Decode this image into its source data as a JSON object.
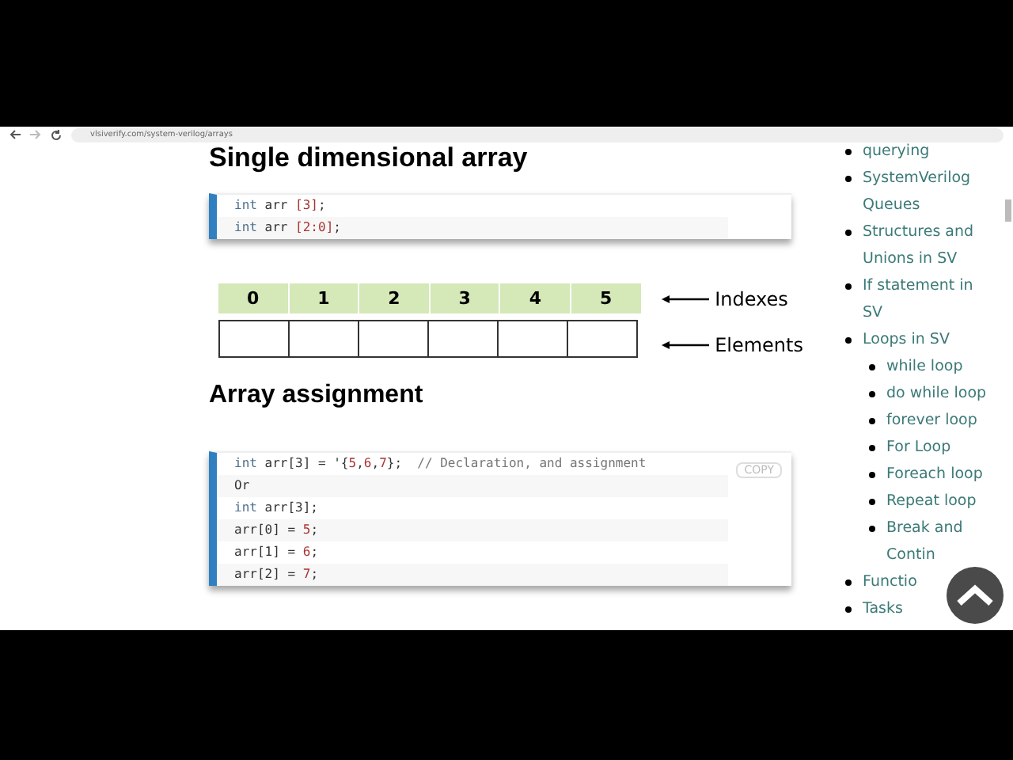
{
  "browser": {
    "url": "vlsiverify.com/system-verilog/arrays"
  },
  "sections": [
    {
      "heading": "Single dimensional array",
      "code": [
        [
          {
            "kind": "type",
            "text": "int"
          },
          {
            "kind": "plain",
            "text": " arr "
          },
          {
            "kind": "num",
            "text": "[3]"
          },
          {
            "kind": "plain",
            "text": ";"
          }
        ],
        [
          {
            "kind": "type",
            "text": "int"
          },
          {
            "kind": "plain",
            "text": " arr "
          },
          {
            "kind": "num",
            "text": "[2:0]"
          },
          {
            "kind": "plain",
            "text": ";"
          }
        ]
      ],
      "diagram": {
        "indexes": [
          "0",
          "1",
          "2",
          "3",
          "4",
          "5"
        ],
        "index_label": "Indexes",
        "element_count_label": "Elements"
      }
    },
    {
      "heading": "Array assignment",
      "copy": "COPY",
      "code": [
        [
          {
            "kind": "type",
            "text": "int"
          },
          {
            "kind": "plain",
            "text": " arr[3] = '{"
          },
          {
            "kind": "num",
            "text": "5"
          },
          {
            "kind": "plain",
            "text": ","
          },
          {
            "kind": "num",
            "text": "6"
          },
          {
            "kind": "plain",
            "text": ","
          },
          {
            "kind": "num",
            "text": "7"
          },
          {
            "kind": "plain",
            "text": "};  "
          },
          {
            "kind": "comment",
            "text": "// Declaration, and assignment"
          }
        ],
        [
          {
            "kind": "plain",
            "text": "Or"
          }
        ],
        [
          {
            "kind": "type",
            "text": "int"
          },
          {
            "kind": "plain",
            "text": " arr[3];"
          }
        ],
        [
          {
            "kind": "plain",
            "text": "arr[0] = "
          },
          {
            "kind": "num",
            "text": "5"
          },
          {
            "kind": "plain",
            "text": ";"
          }
        ],
        [
          {
            "kind": "plain",
            "text": "arr[1] = "
          },
          {
            "kind": "num",
            "text": "6"
          },
          {
            "kind": "plain",
            "text": ";"
          }
        ],
        [
          {
            "kind": "plain",
            "text": "arr[2] = "
          },
          {
            "kind": "num",
            "text": "7"
          },
          {
            "kind": "plain",
            "text": ";"
          }
        ]
      ]
    }
  ],
  "sidebar": {
    "items": [
      {
        "label": "querying"
      },
      {
        "label": "SystemVerilog Queues"
      },
      {
        "label": "Structures and Unions in SV"
      },
      {
        "label": "If statement in SV"
      },
      {
        "label": "Loops in SV",
        "children": [
          {
            "label": "while loop"
          },
          {
            "label": "do while loop"
          },
          {
            "label": "forever loop"
          },
          {
            "label": "For Loop"
          },
          {
            "label": "Foreach loop"
          },
          {
            "label": "Repeat loop"
          },
          {
            "label": "Break and Contin"
          }
        ]
      },
      {
        "label": "Functio"
      },
      {
        "label": "Tasks"
      }
    ]
  }
}
